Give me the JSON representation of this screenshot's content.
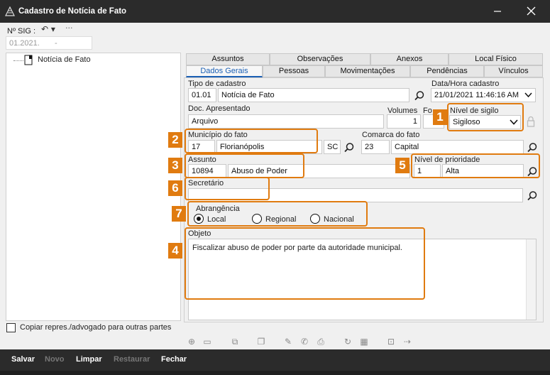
{
  "window": {
    "title": "Cadastro de Notícia de Fato"
  },
  "sig": {
    "label": "Nº SIG :",
    "value": "01.2021.",
    "dash": "-"
  },
  "tree": {
    "item": "Notícia de Fato"
  },
  "tabs_top": [
    "Assuntos",
    "Observações",
    "Anexos",
    "Local Físico"
  ],
  "tabs_bottom": [
    "Dados Gerais",
    "Pessoas",
    "Movimentações",
    "Pendências",
    "Vínculos"
  ],
  "form": {
    "tipo_label": "Tipo de cadastro",
    "tipo_code": "01.01",
    "tipo_name": "Notícia de Fato",
    "data_label": "Data/Hora cadastro",
    "data_value": "21/01/2021 11:46:16 AM",
    "doc_label": "Doc. Apresentado",
    "doc_value": "Arquivo",
    "volumes_label": "Volumes",
    "volumes_value": "1",
    "folhas_label": "Fo",
    "sigilo_label": "Nível de sigilo",
    "sigilo_value": "Sigiloso",
    "municipio_label": "Município do fato",
    "municipio_code": "17",
    "municipio_name": "Florianópolis",
    "municipio_uf": "SC",
    "comarca_label": "Comarca do fato",
    "comarca_code": "23",
    "comarca_name": "Capital",
    "assunto_label": "Assunto",
    "assunto_code": "10894",
    "assunto_name": "Abuso de Poder",
    "prioridade_label": "Nível de prioridade",
    "prioridade_code": "1",
    "prioridade_name": "Alta",
    "secretario_label": "Secretário",
    "abrangencia_label": "Abrangência",
    "abrangencia_options": [
      "Local",
      "Regional",
      "Nacional"
    ],
    "objeto_label": "Objeto",
    "objeto_value": "Fiscalizar abuso de poder por parte da autoridade municipal."
  },
  "checkbox_label": "Copiar repres./advogado para outras partes",
  "badges": [
    "1",
    "2",
    "3",
    "4",
    "5",
    "6",
    "7"
  ],
  "bottom_buttons": [
    "Salvar",
    "Novo",
    "Limpar",
    "Restaurar",
    "Fechar"
  ],
  "colors": {
    "accent": "#e07b10",
    "titlebar": "#2b2b2b",
    "tab_active": "#1a5fb4"
  }
}
